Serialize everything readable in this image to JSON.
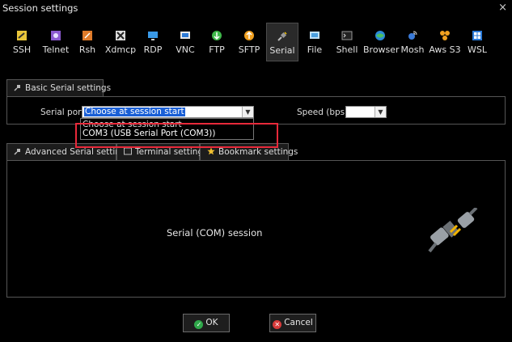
{
  "window": {
    "title": "Session settings",
    "close_glyph": "×"
  },
  "toolbar": {
    "items": [
      {
        "label": "SSH",
        "icon": "ssh-icon"
      },
      {
        "label": "Telnet",
        "icon": "telnet-icon"
      },
      {
        "label": "Rsh",
        "icon": "rsh-icon"
      },
      {
        "label": "Xdmcp",
        "icon": "xdmcp-icon"
      },
      {
        "label": "RDP",
        "icon": "rdp-icon"
      },
      {
        "label": "VNC",
        "icon": "vnc-icon"
      },
      {
        "label": "FTP",
        "icon": "ftp-icon"
      },
      {
        "label": "SFTP",
        "icon": "sftp-icon"
      },
      {
        "label": "Serial",
        "icon": "serial-icon"
      },
      {
        "label": "File",
        "icon": "file-icon"
      },
      {
        "label": "Shell",
        "icon": "shell-icon"
      },
      {
        "label": "Browser",
        "icon": "browser-icon"
      },
      {
        "label": "Mosh",
        "icon": "mosh-icon"
      },
      {
        "label": "Aws S3",
        "icon": "aws-s3-icon"
      },
      {
        "label": "WSL",
        "icon": "wsl-icon"
      }
    ],
    "active": "Serial"
  },
  "basic": {
    "tab_label": "Basic Serial settings",
    "serial_port_label": "Serial port *",
    "serial_port_value": "Choose at session start",
    "speed_label": "Speed (bps) *",
    "speed_value": "",
    "dropdown_options": [
      "Choose at session start",
      "COM3  (USB Serial Port (COM3))"
    ]
  },
  "lower_tabs": [
    {
      "label": "Advanced Serial settings"
    },
    {
      "label": "Terminal settings"
    },
    {
      "label": "Bookmark settings"
    }
  ],
  "main": {
    "description": "Serial (COM) session"
  },
  "buttons": {
    "ok": "OK",
    "cancel": "Cancel"
  },
  "colors": {
    "highlight": "#e8293a",
    "selection": "#1a5fd6"
  }
}
